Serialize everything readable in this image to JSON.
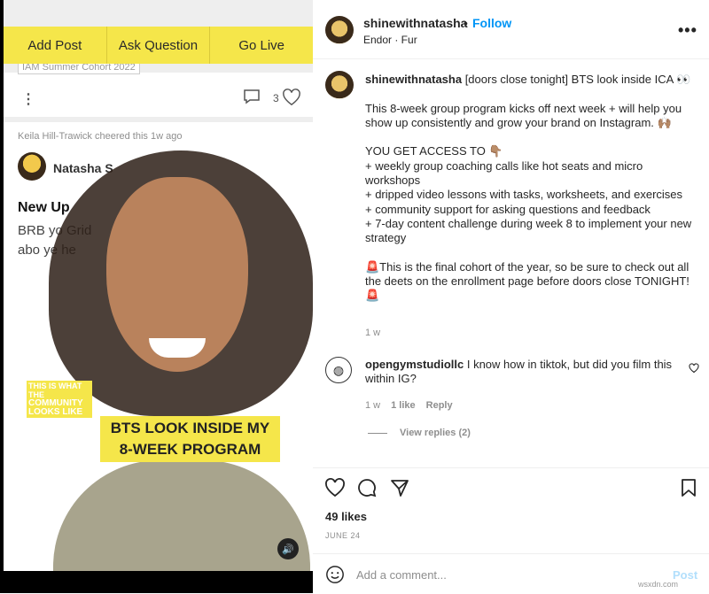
{
  "left_app": {
    "actions": [
      "Add Post",
      "Ask Question",
      "Go Live"
    ],
    "cohort_tag": "IAM Summer Cohort 2022",
    "heart_count": "3",
    "cheer_text": "Keila Hill-Trawick cheered this 1w ago",
    "post_author": "Natasha S",
    "post_title": "New Up",
    "post_body": "BRB yo Grid abo ye he",
    "video_overlay_small": [
      "THIS IS WHAT THE",
      "COMMUNITY",
      "LOOKS LIKE"
    ],
    "video_headline": "BTS LOOK INSIDE MY 8-WEEK PROGRAM"
  },
  "header": {
    "username": "shinewithnatasha",
    "separator": "•",
    "follow_label": "Follow",
    "location": "Endor · Fur",
    "more_icon": "more-horizontal-icon"
  },
  "caption": {
    "username": "shinewithnatasha",
    "text": " [doors close tonight] BTS look inside ICA 👀\n\nThis 8-week group program kicks off next week + will help you show up consistently and grow your brand on Instagram. 🙌🏽\n\nYOU GET ACCESS TO 👇🏽\n+ weekly group coaching calls like hot seats and micro workshops\n+ dripped video lessons with tasks, worksheets, and exercises\n+ community support for asking questions and feedback\n+ 7-day content challenge during week 8 to implement your new strategy\n\n🚨This is the final cohort of the year, so be sure to check out all the deets on the enrollment page before doors close TONIGHT! 🚨",
    "time": "1 w"
  },
  "comment": {
    "username": "opengymstudiollc",
    "text": " I know how in tiktok, but did you film this within IG?",
    "time": "1 w",
    "likes": "1 like",
    "reply": "Reply",
    "view_replies": "View replies (2)"
  },
  "likes": "49 likes",
  "date": "JUNE 24",
  "add_comment": {
    "placeholder": "Add a comment...",
    "post_label": "Post"
  },
  "watermark": "wsxdn.com"
}
